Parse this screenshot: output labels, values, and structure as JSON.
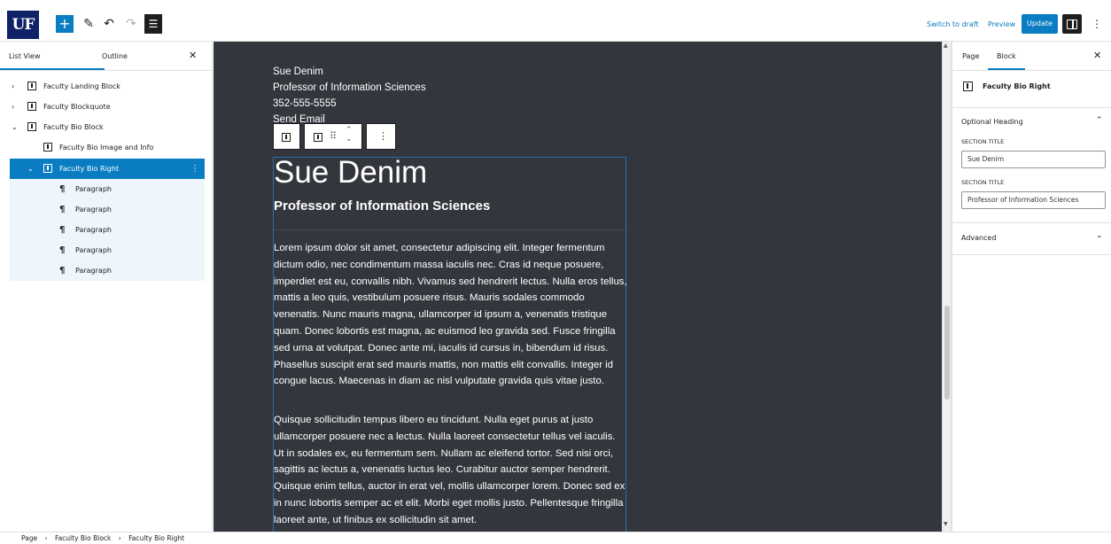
{
  "toolbar": {
    "logo": "UF",
    "add": "+",
    "edit": "✎",
    "undo": "↶",
    "redo": "↷",
    "list_view": "☰",
    "switch_to_draft": "Switch to draft",
    "preview": "Preview",
    "update": "Update",
    "more": "⋮"
  },
  "left_panel": {
    "tab_list_view": "List View",
    "tab_outline": "Outline",
    "close": "✕",
    "tree": [
      {
        "label": "Faculty Landing Block",
        "chev": "›"
      },
      {
        "label": "Faculty Blockquote",
        "chev": "›"
      },
      {
        "label": "Faculty Bio Block",
        "chev": "⌄"
      },
      {
        "label": "Faculty Bio Image and Info",
        "chev": ""
      },
      {
        "label": "Faculty Bio Right",
        "chev": "⌄"
      },
      {
        "label": "Paragraph"
      },
      {
        "label": "Paragraph"
      },
      {
        "label": "Paragraph"
      },
      {
        "label": "Paragraph"
      },
      {
        "label": "Paragraph"
      }
    ]
  },
  "canvas": {
    "info_lines": [
      "Sue Denim",
      "Professor of Information Sciences",
      "352-555-5555",
      "Send Email"
    ],
    "title": "Sue Denim",
    "subtitle": "Professor of Information Sciences",
    "para1": "Lorem ipsum dolor sit amet, consectetur adipiscing elit. Integer fermentum dictum odio, nec condimentum massa iaculis nec. Cras id neque posuere, imperdiet est eu, convallis nibh. Vivamus sed hendrerit lectus. Nulla eros tellus, mattis a leo quis, vestibulum posuere risus. Mauris sodales commodo venenatis. Nunc mauris magna, ullamcorper id ipsum a, venenatis tristique quam. Donec lobortis est magna, ac euismod leo gravida sed. Fusce fringilla sed urna at volutpat. Donec ante mi, iaculis id cursus in, bibendum id risus. Phasellus suscipit erat sed mauris mattis, non mattis elit convallis. Integer id congue lacus. Maecenas in diam ac nisl vulputate gravida quis vitae justo.",
    "para2": "Quisque sollicitudin tempus libero eu tincidunt. Nulla eget purus at justo ullamcorper posuere nec a lectus. Nulla laoreet consectetur tellus vel iaculis. Ut in sodales ex, eu fermentum sem. Nullam ac eleifend tortor. Sed nisi orci, sagittis ac lectus a, venenatis luctus leo. Curabitur auctor semper hendrerit. Quisque enim tellus, auctor in erat vel, mollis ullamcorper lorem. Donec sed ex in nunc lobortis semper ac et elit. Morbi eget mollis justo. Pellentesque fringilla laoreet ante, ut finibus ex sollicitudin sit amet."
  },
  "right_panel": {
    "tab_page": "Page",
    "tab_block": "Block",
    "close": "✕",
    "block_name": "Faculty Bio Right",
    "optional_heading": "Optional Heading",
    "section_title_label_1": "SECTION TITLE",
    "section_title_value_1": "Sue Denim",
    "section_title_label_2": "SECTION TITLE",
    "section_title_value_2": "Professor of Information Sciences",
    "advanced": "Advanced",
    "chev_up": "⌃",
    "chev_down": "⌄"
  },
  "breadcrumb": {
    "items": [
      "Page",
      "Faculty Bio Block",
      "Faculty Bio Right"
    ],
    "sep": "›"
  },
  "colors": {
    "accent": "#0a7cc2",
    "canvas_bg": "#34363d",
    "logo_bg": "#0f2167"
  }
}
